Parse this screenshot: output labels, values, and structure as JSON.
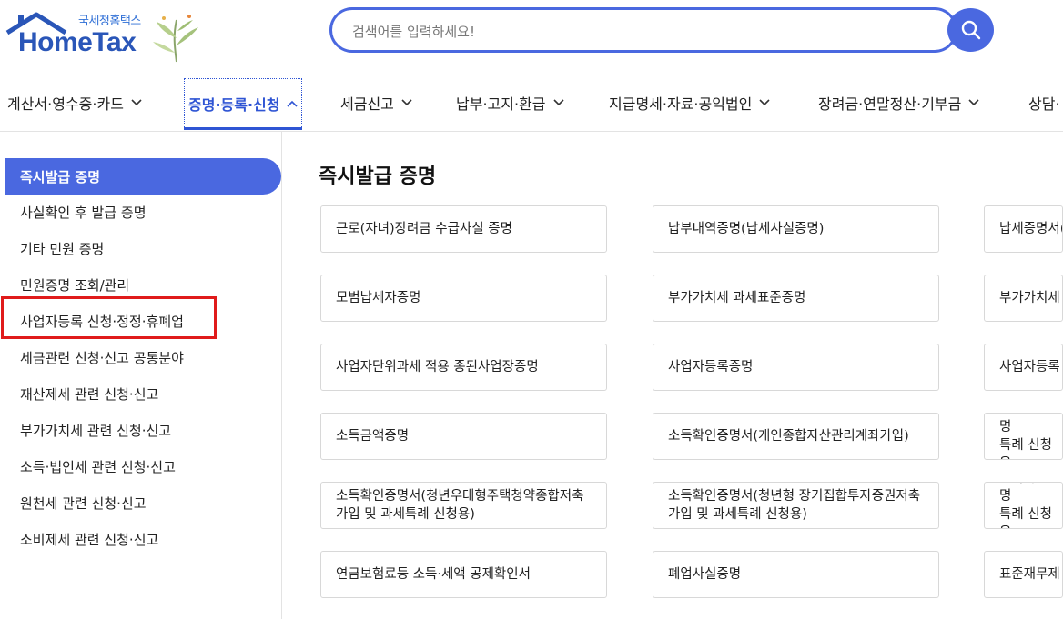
{
  "logo": {
    "subtitle": "국세청홈택스",
    "title": "HomeTax"
  },
  "search": {
    "placeholder": "검색어를 입력하세요!"
  },
  "nav": [
    {
      "label": "계산서·영수증·카드"
    },
    {
      "label": "증명·등록·신청"
    },
    {
      "label": "세금신고"
    },
    {
      "label": "납부·고지·환급"
    },
    {
      "label": "지급명세·자료·공익법인"
    },
    {
      "label": "장려금·연말정산·기부금"
    },
    {
      "label": "상담·"
    }
  ],
  "sidebar": {
    "items": [
      {
        "label": "즉시발급 증명"
      },
      {
        "label": "사실확인 후 발급 증명"
      },
      {
        "label": "기타 민원 증명"
      },
      {
        "label": "민원증명 조회/관리"
      },
      {
        "label": "사업자등록 신청·정정·휴폐업"
      },
      {
        "label": "세금관련 신청·신고 공통분야"
      },
      {
        "label": "재산제세 관련 신청·신고"
      },
      {
        "label": "부가가치세 관련 신청·신고"
      },
      {
        "label": "소득·법인세 관련 신청·신고"
      },
      {
        "label": "원천세 관련 신청·신고"
      },
      {
        "label": "소비제세 관련 신청·신고"
      }
    ]
  },
  "main": {
    "title": "즉시발급 증명",
    "cards": [
      [
        "근로(자녀)장려금 수급사실 증명",
        "납부내역증명(납세사실증명)",
        "납세증명서("
      ],
      [
        "모범납세자증명",
        "부가가치세 과세표준증명",
        "부가가치세"
      ],
      [
        "사업자단위과세 적용 종된사업장증명",
        "사업자등록증명",
        "사업자등록"
      ],
      [
        "소득금액증명",
        "소득확인증명서(개인종합자산관리계좌가입)",
        "소득확인증명\n특례 신청용"
      ],
      [
        "소득확인증명서(청년우대형주택청약종합저축 가입 및 과세특례 신청용)",
        "소득확인증명서(청년형 장기집합투자증권저축 가입 및 과세특례 신청용)",
        "소득확인증명\n특례 신청용"
      ],
      [
        "연금보험료등 소득·세액 공제확인서",
        "폐업사실증명",
        "표준재무제"
      ]
    ]
  }
}
